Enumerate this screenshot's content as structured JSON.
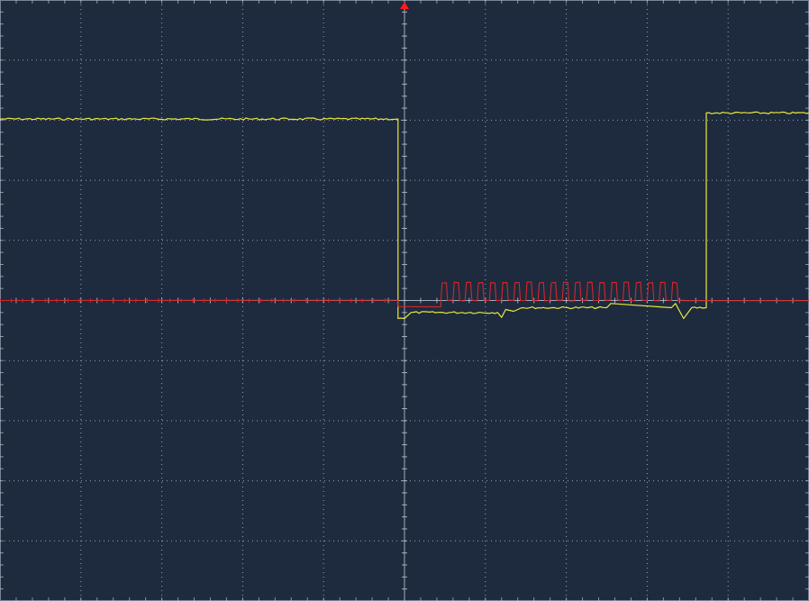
{
  "screen": {
    "background_color": "#1e2a3e",
    "grid_color": "#b8c2d0",
    "trigger_marker_color": "#ff1a1a",
    "trigger_marker_icon": "trigger-arrow-icon"
  },
  "chart_data": {
    "type": "line",
    "title": "",
    "xlabel": "",
    "ylabel": "",
    "xlim": [
      -5,
      5
    ],
    "ylim": [
      -5,
      5
    ],
    "grid": true,
    "x_divisions": 10,
    "y_divisions": 10,
    "minor_ticks_per_division": 5,
    "trigger_position_div": 0,
    "series": [
      {
        "color": "#e8e83a",
        "shape": "pulse",
        "points": [
          [
            -5.0,
            3.02
          ],
          [
            -0.08,
            3.02
          ],
          [
            -0.08,
            -0.3
          ],
          [
            0.0,
            -0.3
          ],
          [
            0.08,
            -0.2
          ],
          [
            1.15,
            -0.2
          ],
          [
            1.2,
            -0.28
          ],
          [
            1.25,
            -0.15
          ],
          [
            1.35,
            -0.18
          ],
          [
            1.45,
            -0.12
          ],
          [
            2.5,
            -0.12
          ],
          [
            2.55,
            -0.05
          ],
          [
            3.3,
            -0.12
          ],
          [
            3.35,
            -0.05
          ],
          [
            3.45,
            -0.3
          ],
          [
            3.55,
            -0.12
          ],
          [
            3.73,
            -0.12
          ],
          [
            3.73,
            3.12
          ],
          [
            5.0,
            3.12
          ]
        ]
      },
      {
        "color": "#d42828",
        "shape": "burst",
        "baseline": 0.0,
        "points": [
          [
            -5.0,
            0.0
          ],
          [
            -0.08,
            0.0
          ],
          [
            -0.08,
            -0.1
          ],
          [
            0.45,
            -0.1
          ],
          [
            0.45,
            0.0
          ]
        ],
        "burst_start": 0.45,
        "burst_end": 3.45,
        "burst_cycles": 20,
        "burst_high": 0.3,
        "burst_low": 0.0,
        "after_burst": [
          [
            3.45,
            0.0
          ],
          [
            5.0,
            0.0
          ]
        ]
      }
    ]
  }
}
